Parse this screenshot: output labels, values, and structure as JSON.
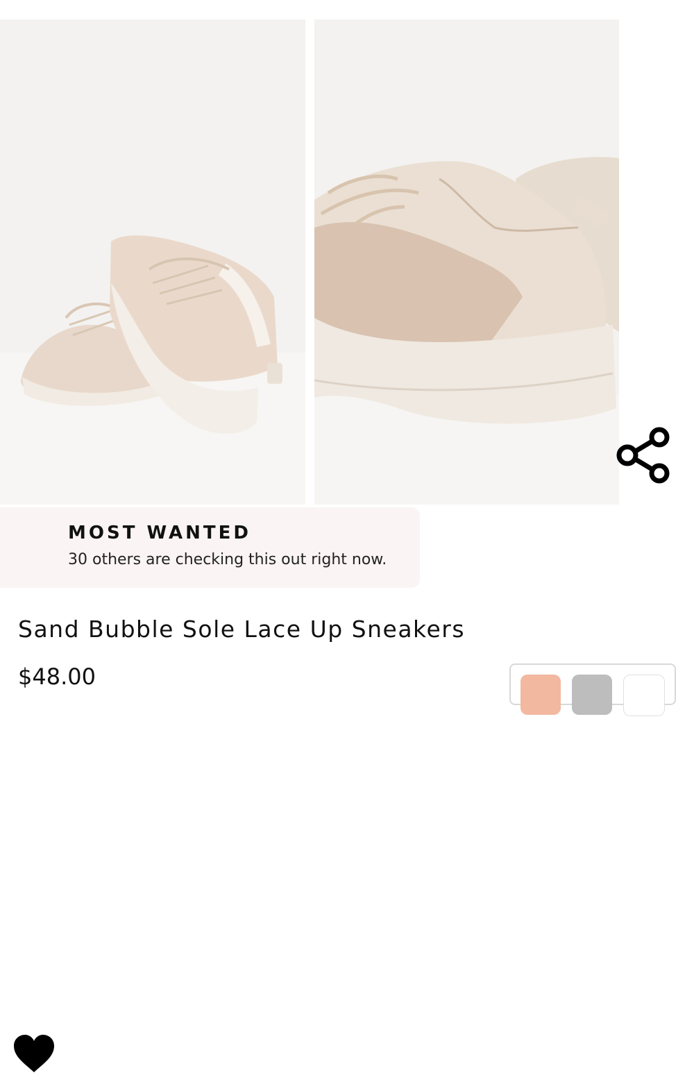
{
  "gallery": {
    "images": [
      {
        "name": "sneakers-pair-view",
        "alt": ""
      },
      {
        "name": "sneaker-heel-closeup",
        "alt": ""
      }
    ]
  },
  "share": {
    "icon": "share-icon"
  },
  "promo": {
    "icon": "heart-icon",
    "title": "MOST WANTED",
    "text": "30 others are checking this out right now."
  },
  "product": {
    "title": "Sand Bubble Sole Lace Up Sneakers",
    "price": "$48.00"
  },
  "swatches": {
    "colors": [
      "#f2b8a0",
      "#bdbdbd",
      "#ffffff"
    ]
  },
  "colors": {
    "photo_bg": "#f3f2f0",
    "promo_bg": "#fbf4f4",
    "text": "#111111"
  }
}
